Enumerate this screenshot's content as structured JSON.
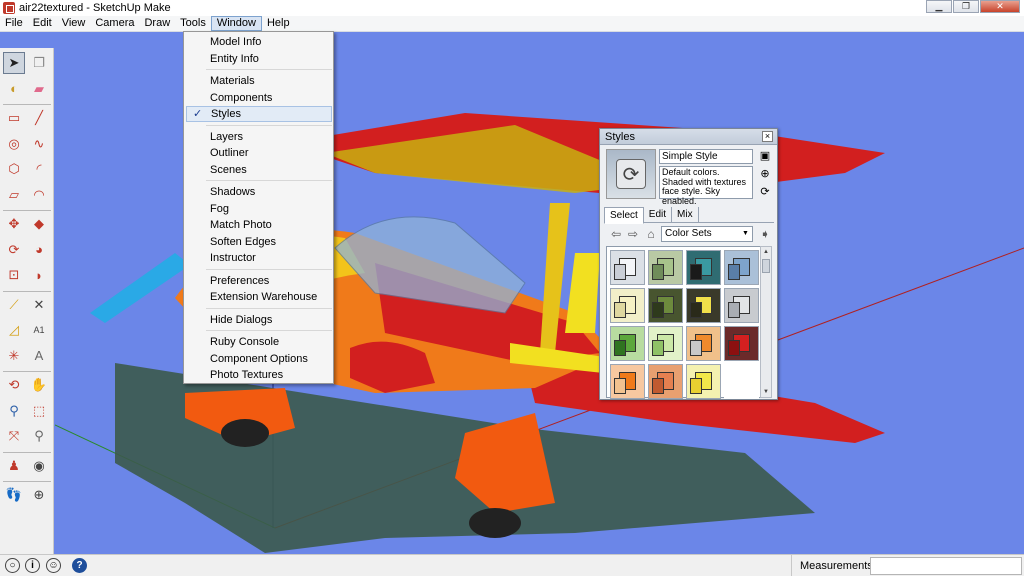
{
  "window": {
    "title": "air22textured - SketchUp Make",
    "controls": [
      "minimize-icon",
      "restore-icon",
      "close-icon"
    ]
  },
  "menubar": {
    "items": [
      "File",
      "Edit",
      "View",
      "Camera",
      "Draw",
      "Tools",
      "Window",
      "Help"
    ],
    "active": "Window"
  },
  "window_menu": {
    "groups": [
      [
        "Model Info",
        "Entity Info"
      ],
      [
        "Materials",
        "Components",
        "Styles"
      ],
      [
        "Layers",
        "Outliner",
        "Scenes"
      ],
      [
        "Shadows",
        "Fog",
        "Match Photo",
        "Soften Edges",
        "Instructor"
      ],
      [
        "Preferences",
        "Extension Warehouse"
      ],
      [
        "Hide Dialogs"
      ],
      [
        "Ruby Console",
        "Component Options",
        "Photo Textures"
      ]
    ],
    "checked": "Styles",
    "check_glyph": "✓"
  },
  "styles_panel": {
    "title": "Styles",
    "close_glyph": "×",
    "style_name": "Simple Style",
    "style_description": "Default colors.  Shaded with textures face style.  Sky enabled.",
    "tabs": [
      "Select",
      "Edit",
      "Mix"
    ],
    "active_tab": "Select",
    "collection": "Color Sets",
    "swatches": [
      {
        "bg": "#dbe0e6",
        "face": "#f3f5f8",
        "side": "#c9ced6"
      },
      {
        "bg": "#b9c9a4",
        "face": "#a7c28b",
        "side": "#6f8c5a"
      },
      {
        "bg": "#2f6c72",
        "face": "#3a9aa2",
        "side": "#1a1a1a"
      },
      {
        "bg": "#aac0d8",
        "face": "#7ea4cc",
        "side": "#5a7ea8"
      },
      {
        "bg": "#f2efc9",
        "face": "#f6f1c4",
        "side": "#dfd8a0"
      },
      {
        "bg": "#48552f",
        "face": "#6d8a3d",
        "side": "#2e3a1c"
      },
      {
        "bg": "#3a3a2a",
        "face": "#f1e04a",
        "side": "#2a2a1a"
      },
      {
        "bg": "#c8cbcf",
        "face": "#e2e4e6",
        "side": "#a9adb3"
      },
      {
        "bg": "#b8dca0",
        "face": "#5ca83c",
        "side": "#2f7420"
      },
      {
        "bg": "#e2f2c8",
        "face": "#cbe8a6",
        "side": "#8fc266"
      },
      {
        "bg": "#f0c08a",
        "face": "#f08a2c",
        "side": "#c8c8c8"
      },
      {
        "bg": "#6b2a2a",
        "face": "#d42020",
        "side": "#8c1010"
      },
      {
        "bg": "#f7c8a0",
        "face": "#f07a1a",
        "side": "#f2c28f"
      },
      {
        "bg": "#e8a070",
        "face": "#e58050",
        "side": "#c05a30"
      },
      {
        "bg": "#f4f1b0",
        "face": "#f2e84a",
        "side": "#e8d030"
      },
      {
        "bg": "#ffffff",
        "face": "#ffffff",
        "side": "#ffffff"
      }
    ]
  },
  "left_toolbar": {
    "tools": [
      {
        "name": "select-tool",
        "glyph": "➤",
        "color": "#222"
      },
      {
        "name": "make-component-tool",
        "glyph": "❐",
        "color": "#888"
      },
      {
        "name": "paint-bucket-tool",
        "glyph": "◐",
        "color": "#c89b2a"
      },
      {
        "name": "eraser-tool",
        "glyph": "▰",
        "color": "#e06a8c"
      },
      {
        "name": "rectangle-tool",
        "glyph": "▭",
        "color": "#c0392b"
      },
      {
        "name": "line-tool",
        "glyph": "╱",
        "color": "#c0392b"
      },
      {
        "name": "circle-tool",
        "glyph": "◎",
        "color": "#c0392b"
      },
      {
        "name": "freehand-tool",
        "glyph": "∿",
        "color": "#c0392b"
      },
      {
        "name": "polygon-tool",
        "glyph": "⬡",
        "color": "#c0392b"
      },
      {
        "name": "arc-tool",
        "glyph": "◜",
        "color": "#c0392b"
      },
      {
        "name": "rotated-rectangle-tool",
        "glyph": "▱",
        "color": "#c0392b"
      },
      {
        "name": "pie-tool",
        "glyph": "◠",
        "color": "#c0392b"
      },
      {
        "name": "move-tool",
        "glyph": "✥",
        "color": "#c0392b"
      },
      {
        "name": "push-pull-tool",
        "glyph": "◆",
        "color": "#c0392b"
      },
      {
        "name": "rotate-tool",
        "glyph": "⟳",
        "color": "#c0392b"
      },
      {
        "name": "follow-me-tool",
        "glyph": "◕",
        "color": "#c0392b"
      },
      {
        "name": "scale-tool",
        "glyph": "⊡",
        "color": "#c0392b"
      },
      {
        "name": "offset-tool",
        "glyph": "◗",
        "color": "#c0392b"
      },
      {
        "name": "tape-measure-tool",
        "glyph": "⟋",
        "color": "#d4a017"
      },
      {
        "name": "dimension-tool",
        "glyph": "✕",
        "color": "#444"
      },
      {
        "name": "protractor-tool",
        "glyph": "◿",
        "color": "#d4a017"
      },
      {
        "name": "text-tool",
        "glyph": "A1",
        "color": "#444"
      },
      {
        "name": "axes-tool",
        "glyph": "✳",
        "color": "#c0392b"
      },
      {
        "name": "3d-text-tool",
        "glyph": "A",
        "color": "#666"
      },
      {
        "name": "orbit-tool",
        "glyph": "⟲",
        "color": "#c0392b"
      },
      {
        "name": "pan-tool",
        "glyph": "✋",
        "color": "#444"
      },
      {
        "name": "zoom-tool",
        "glyph": "⚲",
        "color": "#2c5fa8"
      },
      {
        "name": "zoom-window-tool",
        "glyph": "⬚",
        "color": "#c0392b"
      },
      {
        "name": "zoom-extents-tool",
        "glyph": "⤧",
        "color": "#c0392b"
      },
      {
        "name": "previous-view-tool",
        "glyph": "⚲",
        "color": "#666"
      },
      {
        "name": "position-camera-tool",
        "glyph": "♟",
        "color": "#c0392b"
      },
      {
        "name": "look-around-tool",
        "glyph": "◉",
        "color": "#444"
      },
      {
        "name": "walk-tool",
        "glyph": "👣",
        "color": "#222"
      },
      {
        "name": "section-plane-tool",
        "glyph": "⊕",
        "color": "#444"
      }
    ]
  },
  "statusbar": {
    "icons": [
      "geo-location-icon",
      "credits-icon",
      "user-icon",
      "help-icon"
    ],
    "help_glyph": "?",
    "credits_glyph": "ⓘ",
    "measurements_label": "Measurements",
    "measurements_value": ""
  },
  "colors": {
    "sky": "#6b86e8",
    "ground": "#6b86e8",
    "menu_highlight": "#d9e4f3"
  }
}
